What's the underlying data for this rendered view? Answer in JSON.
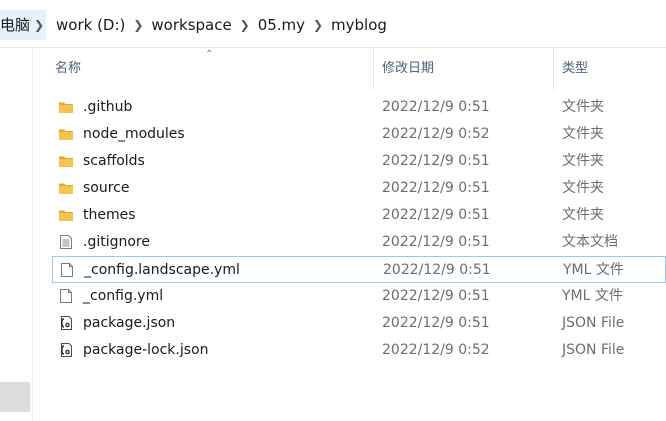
{
  "breadcrumb": {
    "root_fragment": "电脑",
    "items": [
      "work (D:)",
      "workspace",
      "05.my",
      "myblog"
    ]
  },
  "columns": {
    "name": "名称",
    "date": "修改日期",
    "type": "类型"
  },
  "files": [
    {
      "name": ".github",
      "date": "2022/12/9 0:51",
      "type": "文件夹",
      "icon": "folder-icon"
    },
    {
      "name": "node_modules",
      "date": "2022/12/9 0:52",
      "type": "文件夹",
      "icon": "folder-icon"
    },
    {
      "name": "scaffolds",
      "date": "2022/12/9 0:51",
      "type": "文件夹",
      "icon": "folder-icon"
    },
    {
      "name": "source",
      "date": "2022/12/9 0:51",
      "type": "文件夹",
      "icon": "folder-icon"
    },
    {
      "name": "themes",
      "date": "2022/12/9 0:51",
      "type": "文件夹",
      "icon": "folder-icon"
    },
    {
      "name": ".gitignore",
      "date": "2022/12/9 0:51",
      "type": "文本文档",
      "icon": "text-document-icon"
    },
    {
      "name": "_config.landscape.yml",
      "date": "2022/12/9 0:51",
      "type": "YML 文件",
      "icon": "blank-file-icon"
    },
    {
      "name": "_config.yml",
      "date": "2022/12/9 0:51",
      "type": "YML 文件",
      "icon": "blank-file-icon"
    },
    {
      "name": "package.json",
      "date": "2022/12/9 0:51",
      "type": "JSON File",
      "icon": "json-file-icon"
    },
    {
      "name": "package-lock.json",
      "date": "2022/12/9 0:52",
      "type": "JSON File",
      "icon": "json-file-icon"
    }
  ],
  "colors": {
    "folder": "#f4c44e",
    "folder_dark": "#e6a824",
    "selection_border": "#99c9ef",
    "header_text": "#4c607a",
    "secondary_text": "#6d6d6d"
  }
}
